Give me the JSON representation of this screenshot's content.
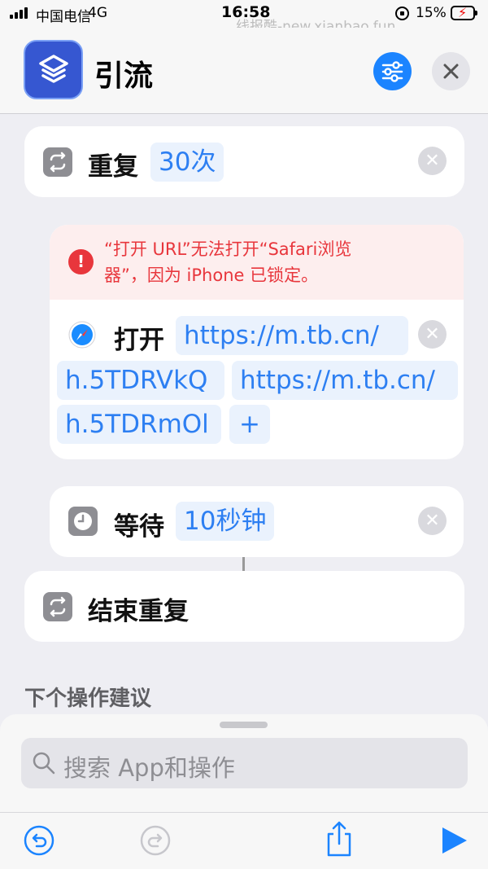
{
  "status": {
    "carrier": "中国电信",
    "network": "4G",
    "time": "16:58",
    "battery": "15%",
    "watermark": "线报酷-new.xianbao.fun"
  },
  "header": {
    "title": "引流",
    "app_icon": "shortcuts-icon"
  },
  "actions": [
    {
      "verb": "重复",
      "token": "30次",
      "icon": "repeat-icon"
    },
    {
      "error": "“打开 URL”无法打开“Safari浏览器”，因为 iPhone 已锁定。",
      "error_lines": [
        "“打开 URL”无法打开“Safari浏览",
        "器”，因为 iPhone 已锁定。"
      ],
      "verb": "打开",
      "url_line1": "https://m.tb.cn/",
      "url_line2": "h.5TDRVkQ",
      "url_line3": "https://m.tb.cn/",
      "url_line4": "h.5TDRmOl",
      "add_label": "+",
      "icon": "safari-icon"
    },
    {
      "verb": "等待",
      "token": "10秒钟",
      "icon": "clock-icon"
    },
    {
      "verb": "结束重复",
      "icon": "repeat-icon"
    }
  ],
  "suggestions_label": "下个操作建议",
  "search": {
    "placeholder": "搜索 App和操作"
  },
  "colors": {
    "accent": "#2d7ff2",
    "error": "#e8363c",
    "brand": "#3657d1"
  }
}
